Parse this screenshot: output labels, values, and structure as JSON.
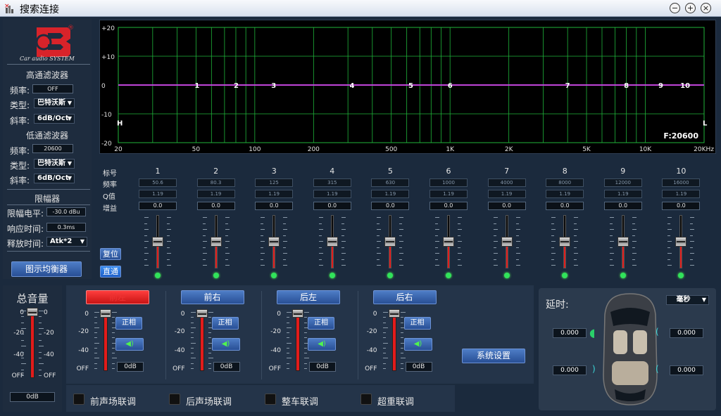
{
  "window": {
    "title": "搜索连接"
  },
  "brand": {
    "logo_text": "Car audio SYSTEM",
    "logo_letters": "B",
    "registered": "®"
  },
  "high_pass": {
    "title": "高通滤波器",
    "freq_label": "频率:",
    "freq_value": "OFF",
    "type_label": "类型:",
    "type_value": "巴特沃斯",
    "slope_label": "斜率:",
    "slope_value": "6dB/Oct"
  },
  "low_pass": {
    "title": "低通滤波器",
    "freq_label": "频率:",
    "freq_value": "20600",
    "type_label": "类型:",
    "type_value": "巴特沃斯",
    "slope_label": "斜率:",
    "slope_value": "6dB/Oct"
  },
  "limiter": {
    "title": "限幅器",
    "level_label": "限幅电平:",
    "level_value": "-30.0 dBu",
    "attack_label": "响应时间:",
    "attack_value": "0.3ms",
    "release_label": "释放时间:",
    "release_value": "Atk*2"
  },
  "graphic_eq_button": "图示均衡器",
  "graph": {
    "y_labels": [
      "+20",
      "+10",
      "0",
      "-10",
      "-20"
    ],
    "x_labels": [
      "20",
      "50",
      "100",
      "200",
      "500",
      "1K",
      "2K",
      "5K",
      "10K",
      "20KHz"
    ],
    "band_markers": [
      "1",
      "2",
      "3",
      "4",
      "5",
      "6",
      "7",
      "8",
      "9",
      "10"
    ],
    "hp_marker": "H",
    "lp_marker": "L",
    "freq_readout": "F:20600",
    "grid_color": "#1fb53a",
    "curve_color": "#c044d8"
  },
  "eq": {
    "row_labels": {
      "index": "标号",
      "freq": "频率",
      "q": "Q值",
      "gain": "增益"
    },
    "reset_button": "复位",
    "bypass_button": "直通",
    "bands": [
      {
        "num": "1",
        "freq": "50.6",
        "q": "1.19",
        "gain": "0.0"
      },
      {
        "num": "2",
        "freq": "80.3",
        "q": "1.19",
        "gain": "0.0"
      },
      {
        "num": "3",
        "freq": "125",
        "q": "1.19",
        "gain": "0.0"
      },
      {
        "num": "4",
        "freq": "315",
        "q": "1.19",
        "gain": "0.0"
      },
      {
        "num": "5",
        "freq": "630",
        "q": "1.19",
        "gain": "0.0"
      },
      {
        "num": "6",
        "freq": "1000",
        "q": "1.19",
        "gain": "0.0"
      },
      {
        "num": "7",
        "freq": "4000",
        "q": "1.19",
        "gain": "0.0"
      },
      {
        "num": "8",
        "freq": "8000",
        "q": "1.19",
        "gain": "0.0"
      },
      {
        "num": "9",
        "freq": "12000",
        "q": "1.19",
        "gain": "0.0"
      },
      {
        "num": "10",
        "freq": "16000",
        "q": "1.19",
        "gain": "0.0"
      }
    ]
  },
  "master": {
    "title": "总音量",
    "scale_left": [
      "0",
      "-20",
      "-40",
      "OFF"
    ],
    "scale_right": [
      "0",
      "-20",
      "-40",
      "OFF"
    ],
    "value": "0dB"
  },
  "channels": [
    {
      "name": "前左",
      "phase": "正相",
      "value": "0dB",
      "scale": [
        "0",
        "-20",
        "-40",
        "OFF"
      ],
      "active": true
    },
    {
      "name": "前右",
      "phase": "正相",
      "value": "0dB",
      "scale": [
        "0",
        "-20",
        "-40",
        "OFF"
      ],
      "active": false
    },
    {
      "name": "后左",
      "phase": "正相",
      "value": "0dB",
      "scale": [
        "0",
        "-20",
        "-40",
        "OFF"
      ],
      "active": false
    },
    {
      "name": "后右",
      "phase": "正相",
      "value": "0dB",
      "scale": [
        "0",
        "-20",
        "-40",
        "OFF"
      ],
      "active": false
    }
  ],
  "system_settings_button": "系统设置",
  "links": [
    {
      "label": "前声场联调"
    },
    {
      "label": "后声场联调"
    },
    {
      "label": "整车联调"
    },
    {
      "label": "超重联调"
    }
  ],
  "delay": {
    "title": "延时:",
    "unit": "毫秒",
    "front_left": "0.000",
    "front_right": "0.000",
    "rear_left": "0.000",
    "rear_right": "0.000"
  }
}
